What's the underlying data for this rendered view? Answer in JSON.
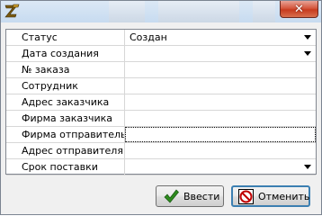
{
  "window": {
    "icon": "app-z-logo-icon",
    "close_label": "✕"
  },
  "fields": [
    {
      "label": "Статус",
      "value": "Создан",
      "dropdown": true
    },
    {
      "label": "Дата создания",
      "value": "",
      "dropdown": true
    },
    {
      "label": "№ заказа",
      "value": "",
      "dropdown": false
    },
    {
      "label": "Сотрудник",
      "value": "",
      "dropdown": false
    },
    {
      "label": "Адрес заказчика",
      "value": "",
      "dropdown": false
    },
    {
      "label": "Фирма заказчика",
      "value": "",
      "dropdown": false
    },
    {
      "label": "Фирма отправитель",
      "value": "",
      "dropdown": false,
      "focused": true
    },
    {
      "label": "Адрес отправителя",
      "value": "",
      "dropdown": false
    },
    {
      "label": "Срок поставки",
      "value": "",
      "dropdown": true
    }
  ],
  "buttons": {
    "ok_label": "Ввести",
    "ok_icon": "checkmark-icon",
    "cancel_label": "Отменить",
    "cancel_icon": "no-entry-icon"
  },
  "colors": {
    "titlebar": "#c7dbf0",
    "close": "#c73b1f",
    "check": "#2e8b1e",
    "cancel_icon": "#c00000"
  }
}
